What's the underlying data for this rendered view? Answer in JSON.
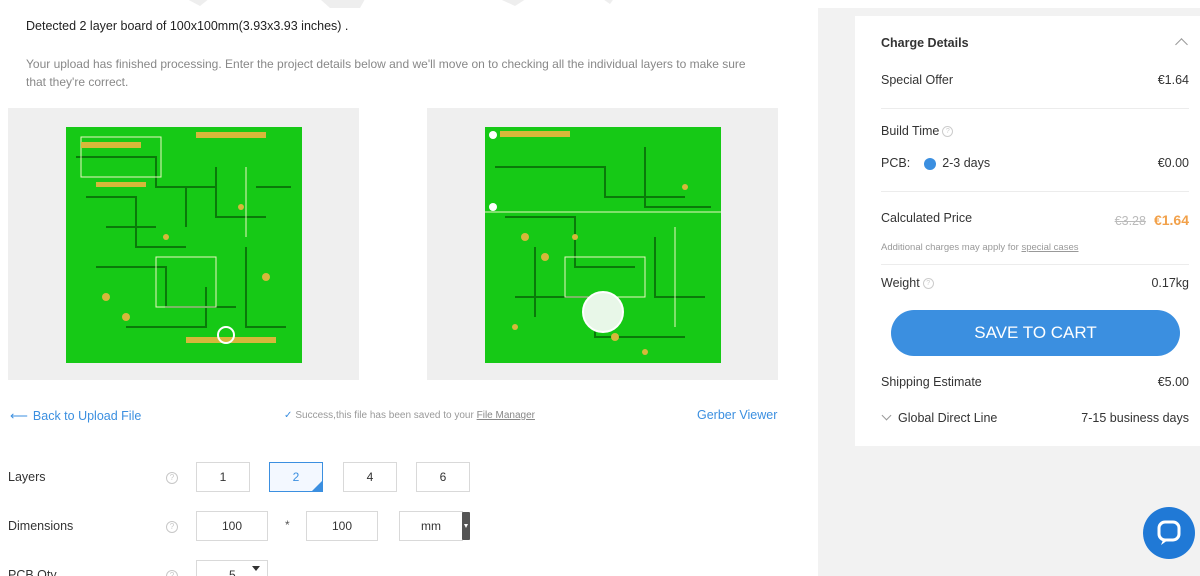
{
  "header": {
    "detected": "Detected 2 layer board of 100x100mm(3.93x3.93 inches) .",
    "intro": "Your upload has finished processing. Enter the project details below and we'll move on to checking all the individual layers to make sure that they're correct."
  },
  "links": {
    "back": "Back to Upload File",
    "success_text": "Success,this file has been saved to your",
    "file_manager": "File Manager",
    "gerber_viewer": "Gerber Viewer"
  },
  "options": {
    "layers": {
      "label": "Layers",
      "values": [
        "1",
        "2",
        "4",
        "6"
      ],
      "selected": "2"
    },
    "dimensions": {
      "label": "Dimensions",
      "width": "100",
      "separator": "*",
      "height": "100",
      "unit": "mm"
    },
    "pcb_qty": {
      "label": "PCB Qty",
      "value": "5"
    }
  },
  "charge": {
    "title": "Charge Details",
    "special_offer_label": "Special Offer",
    "special_offer_value": "€1.64",
    "build_time_label": "Build Time",
    "pcb_label": "PCB:",
    "pcb_option": "2-3 days",
    "pcb_value": "€0.00",
    "calculated_label": "Calculated Price",
    "old_price": "€3.28",
    "new_price": "€1.64",
    "note_text": "Additional charges may apply for",
    "note_link": "special cases",
    "weight_label": "Weight",
    "weight_value": "0.17kg",
    "cart_button": "SAVE TO CART",
    "shipping_label": "Shipping Estimate",
    "shipping_value": "€5.00",
    "line_label": "Global Direct Line",
    "line_value": "7-15 business days"
  },
  "colors": {
    "accent": "#3b8fe0",
    "price": "#f2a14a",
    "pcb_green": "#16c916",
    "panel_bg": "#f2f2f2"
  },
  "icons": [
    "back-arrow-icon",
    "check-icon",
    "help-icon",
    "chevron-up-icon",
    "chevron-down-icon",
    "chat-icon"
  ]
}
